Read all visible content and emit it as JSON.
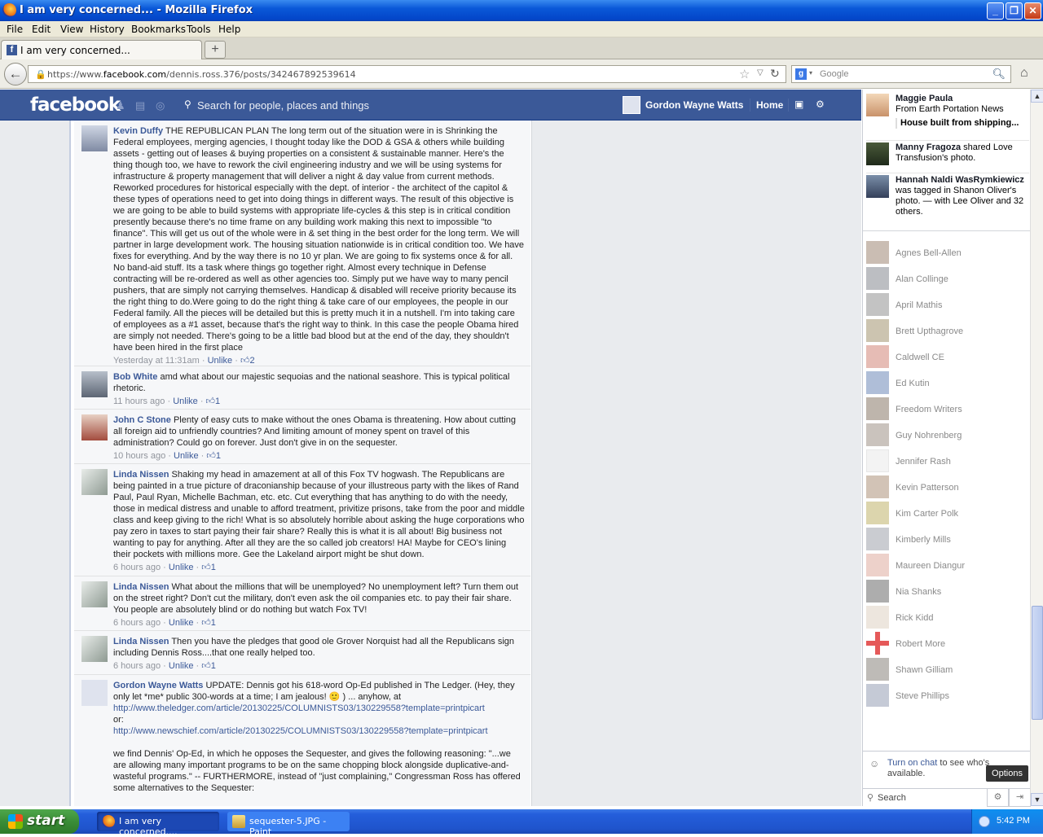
{
  "window": {
    "title": "I am very concerned... - Mozilla Firefox",
    "minimize_label": "_",
    "maximize_label": "❐",
    "close_label": "✕"
  },
  "menu": [
    "File",
    "Edit",
    "View",
    "History",
    "Bookmarks",
    "Tools",
    "Help"
  ],
  "tabs": [
    {
      "label": "I am very concerned..."
    }
  ],
  "new_tab_label": "+",
  "nav": {
    "url_prefix": "https://www.",
    "url_host": "facebook.com",
    "url_path": "/dennis.ross.376/posts/342467892539614",
    "search_placeholder": "Google"
  },
  "fb_header": {
    "logo": "facebook",
    "search_placeholder": "Search for people, places and things",
    "user_name": "Gordon Wayne Watts",
    "home": "Home"
  },
  "comments": [
    {
      "author": "Kevin Duffy",
      "text": "THE REPUBLICAN PLAN The long term out of the situation were in is Shrinking the Federal employees, merging agencies, I thought today like the DOD & GSA & others while building assets - getting out of leases & buying properties on a consistent & sustainable manner. Here's the thing though too, we have to rework the civil engineering industry and we will be using systems for infrastructure & property management that will deliver a night & day value from current methods. Reworked procedures for historical especially with the dept. of interior - the architect of the capitol & these types of operations need to get into doing things in different ways. The result of this objective is we are going to be able to build systems with appropriate life-cycles & this step is in critical condition presently because there's no time frame on any building work making this next to impossible \"to finance\". This will get us out of the whole were in & set thing in the best order for the long term. We will partner in large development work. The housing situation nationwide is in critical condition too. We have fixes for everything. And by the way there is no 10 yr plan. We are going to fix systems once & for all. No band-aid stuff. Its a task where things go together right. Almost every technique in Defense contracting will be re-ordered as well as other agencies too. Simply put we have way to many pencil pushers, that are simply not carrying themselves. Handicap & disabled will receive priority because its the right thing to do.Were going to do the right thing & take care of our employees, the people in our Federal family. All the pieces will be detailed but this is pretty much it in a nutshell. I'm into taking care of employees as a #1 asset, because that's the right way to think. In this case the people Obama hired are simply not needed. There's going to be a little bad blood but at the end of the day, they shouldn't have been hired in the first place",
      "time": "Yesterday at 11:31am",
      "action": "Unlike",
      "likes": "2"
    },
    {
      "author": "Bob White",
      "text": "amd what about our majestic sequoias and the national seashore. This is typical political rhetoric.",
      "time": "11 hours ago",
      "action": "Unlike",
      "likes": "1"
    },
    {
      "author": "John C Stone",
      "text": "Plenty of easy cuts to make without the ones Obama is threatening. How about cutting all foreign aid to unfriendly countries? And limiting amount of money spent on travel of this administration? Could go on forever. Just don't give in on the sequester.",
      "time": "10 hours ago",
      "action": "Unlike",
      "likes": "1"
    },
    {
      "author": "Linda Nissen",
      "text": "Shaking my head in amazement at all of this Fox TV hogwash. The Republicans are being painted in a true picture of draconianship because of your illustreous party with the likes of Rand Paul, Paul Ryan, Michelle Bachman, etc. etc. Cut everything that has anything to do with the needy, those in medical distress and unable to afford treatment, privitize prisons, take from the poor and middle class and keep giving to the rich! What is so absolutely horrible about asking the huge corporations who pay zero in taxes to start paying their fair share? Really this is what it is all about! Big business not wanting to pay for anything. After all they are the so called job creators! HA! Maybe for CEO's lining their pockets with millions more. Gee the Lakeland airport might be shut down.",
      "time": "6 hours ago",
      "action": "Unlike",
      "likes": "1"
    },
    {
      "author": "Linda Nissen",
      "text": "What about the millions that will be unemployed? No unemployment left? Turn them out on the street right? Don't cut the military, don't even ask the oil companies etc. to pay their fair share. You people are absolutely blind or do nothing but watch Fox TV!",
      "time": "6 hours ago",
      "action": "Unlike",
      "likes": "1"
    },
    {
      "author": "Linda Nissen",
      "text": "Then you have the pledges that good ole Grover Norquist had all the Republicans sign including Dennis Ross....that one really helped too.",
      "time": "6 hours ago",
      "action": "Unlike",
      "likes": "1"
    },
    {
      "author": "Gordon Wayne Watts",
      "text": "UPDATE: Dennis got his 618-word Op-Ed published in The Ledger. (Hey, they only let *me* public 300-words at a time; I am jealous! 🙂 ) ... anyhow, at",
      "link1": "http://www.theledger.com/article/20130225/COLUMNISTS03/130229558?template=printpicart",
      "or": "or:",
      "link2": "http://www.newschief.com/article/20130225/COLUMNISTS03/130229558?template=printpicart",
      "text2": "we find Dennis' Op-Ed, in which he opposes the Sequester, and gives the following reasoning: \"...we are allowing many important programs to be on the same chopping block alongside duplicative-and-wasteful programs.\" -- FURTHERMORE, instead of \"just complaining,\" Congressman Ross has offered some alternatives to the Sequester:"
    }
  ],
  "ticker": [
    {
      "name": "Maggie Paula",
      "line": "From Earth Portation News",
      "sub": "House built from shipping..."
    },
    {
      "name": "Manny Fragoza",
      "line": "shared Love Transfusion's photo."
    },
    {
      "name": "Hannah Naldi WasRymkiewicz",
      "line": "was tagged in Shanon Oliver's photo. — with Lee Oliver and 32 others."
    }
  ],
  "chat_friends": [
    "Agnes Bell-Allen",
    "Alan Collinge",
    "April Mathis",
    "Brett Upthagrove",
    "Caldwell CE",
    "Ed Kutin",
    "Freedom Writers",
    "Guy Nohrenberg",
    "Jennifer Rash",
    "Kevin Patterson",
    "Kim Carter Polk",
    "Kimberly Mills",
    "Maureen Diangur",
    "Nia Shanks",
    "Rick Kidd",
    "Robert More",
    "Shawn Gilliam",
    "Steve Phillips"
  ],
  "chat": {
    "turn_on_link": "Turn on chat",
    "turn_on_rest": "to see who's available.",
    "search_placeholder": "Search",
    "options_tooltip": "Options"
  },
  "taskbar": {
    "start": "start",
    "items": [
      {
        "label": "I am very concerned...."
      },
      {
        "label": "sequester-5.JPG - Paint"
      }
    ],
    "clock": "5:42 PM"
  }
}
